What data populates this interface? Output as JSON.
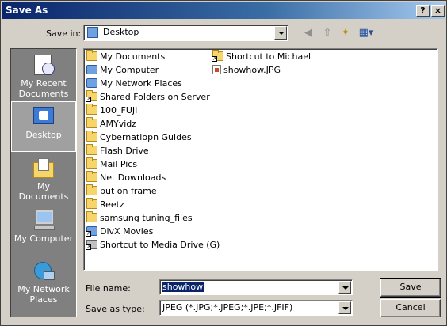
{
  "window": {
    "title": "Save As",
    "help_glyph": "?",
    "close_glyph": "×"
  },
  "save_in": {
    "label": "Save in:",
    "value": "Desktop",
    "icon": "desktop-icon"
  },
  "toolbar": {
    "back_icon": "back-icon",
    "up_icon": "up-folder-icon",
    "new_folder_icon": "new-folder-icon",
    "views_icon": "views-menu-icon"
  },
  "places": [
    {
      "label": "My Recent Documents",
      "icon": "recent-documents-icon",
      "active": false
    },
    {
      "label": "Desktop",
      "icon": "desktop-icon",
      "active": true
    },
    {
      "label": "My Documents",
      "icon": "my-documents-icon",
      "active": false
    },
    {
      "label": "My Computer",
      "icon": "my-computer-icon",
      "active": false
    },
    {
      "label": "My Network Places",
      "icon": "network-places-icon",
      "active": false
    }
  ],
  "files_col1": [
    {
      "name": "My Documents",
      "icon": "folder"
    },
    {
      "name": "My Computer",
      "icon": "special"
    },
    {
      "name": "My Network Places",
      "icon": "special"
    },
    {
      "name": "Shared Folders on Server",
      "icon": "folder",
      "shortcut": true
    },
    {
      "name": "100_FUJI",
      "icon": "folder"
    },
    {
      "name": "AMYvidz",
      "icon": "folder"
    },
    {
      "name": "Cybernatiopn Guides",
      "icon": "folder"
    },
    {
      "name": "Flash Drive",
      "icon": "folder"
    },
    {
      "name": "Mail Pics",
      "icon": "folder"
    },
    {
      "name": "Net Downloads",
      "icon": "folder"
    },
    {
      "name": "put on frame",
      "icon": "folder"
    },
    {
      "name": "Reetz",
      "icon": "folder"
    },
    {
      "name": "samsung tuning_files",
      "icon": "folder"
    },
    {
      "name": "DivX Movies",
      "icon": "special",
      "shortcut": true
    },
    {
      "name": "Shortcut to Media Drive (G)",
      "icon": "drive",
      "shortcut": true
    }
  ],
  "files_col2": [
    {
      "name": "Shortcut to Michael",
      "icon": "folder",
      "shortcut": true
    },
    {
      "name": "showhow.JPG",
      "icon": "file"
    }
  ],
  "filename": {
    "label": "File name:",
    "value": "showhow"
  },
  "filetype": {
    "label": "Save as type:",
    "value": "JPEG (*.JPG;*.JPEG;*.JPE;*.JFIF)"
  },
  "buttons": {
    "save": "Save",
    "cancel": "Cancel"
  }
}
